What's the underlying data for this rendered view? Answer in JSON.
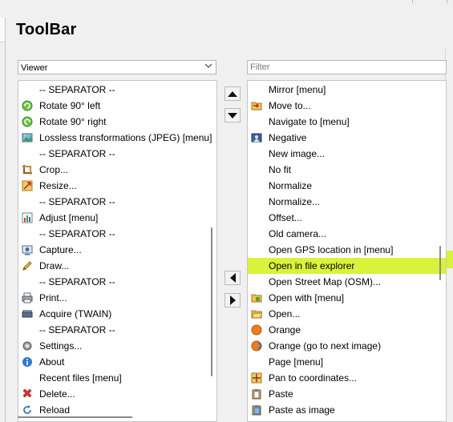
{
  "page": {
    "title": "ToolBar"
  },
  "left": {
    "dropdown_value": "Viewer",
    "items": [
      {
        "label": "-- SEPARATOR --",
        "icon": ""
      },
      {
        "label": "Rotate 90° left",
        "icon": "rotate-left-icon"
      },
      {
        "label": "Rotate 90° right",
        "icon": "rotate-right-icon"
      },
      {
        "label": "Lossless transformations (JPEG) [menu]",
        "icon": "lossless-transform-icon"
      },
      {
        "label": "-- SEPARATOR --",
        "icon": ""
      },
      {
        "label": "Crop...",
        "icon": "crop-icon"
      },
      {
        "label": "Resize...",
        "icon": "resize-icon"
      },
      {
        "label": "-- SEPARATOR --",
        "icon": ""
      },
      {
        "label": "Adjust [menu]",
        "icon": "adjust-icon"
      },
      {
        "label": "-- SEPARATOR --",
        "icon": ""
      },
      {
        "label": "Capture...",
        "icon": "capture-icon"
      },
      {
        "label": "Draw...",
        "icon": "draw-icon"
      },
      {
        "label": "-- SEPARATOR --",
        "icon": ""
      },
      {
        "label": "Print...",
        "icon": "print-icon"
      },
      {
        "label": "Acquire (TWAIN)",
        "icon": "scanner-icon"
      },
      {
        "label": "-- SEPARATOR --",
        "icon": ""
      },
      {
        "label": "Settings...",
        "icon": "settings-icon"
      },
      {
        "label": "About",
        "icon": "about-icon"
      },
      {
        "label": "Recent files [menu]",
        "icon": ""
      },
      {
        "label": "Delete...",
        "icon": "delete-icon"
      },
      {
        "label": "Reload",
        "icon": "reload-icon"
      }
    ]
  },
  "right": {
    "filter_placeholder": "Filter",
    "items": [
      {
        "label": "Mirror [menu]",
        "icon": ""
      },
      {
        "label": "Move to...",
        "icon": "move-to-icon"
      },
      {
        "label": "Navigate to [menu]",
        "icon": ""
      },
      {
        "label": "Negative",
        "icon": "negative-icon"
      },
      {
        "label": "New image...",
        "icon": ""
      },
      {
        "label": "No fit",
        "icon": ""
      },
      {
        "label": "Normalize",
        "icon": ""
      },
      {
        "label": "Normalize...",
        "icon": ""
      },
      {
        "label": "Offset...",
        "icon": ""
      },
      {
        "label": "Old camera...",
        "icon": ""
      },
      {
        "label": "Open GPS location in [menu]",
        "icon": ""
      },
      {
        "label": "Open in file explorer",
        "icon": ""
      },
      {
        "label": "Open Street Map (OSM)...",
        "icon": ""
      },
      {
        "label": "Open with [menu]",
        "icon": "open-with-icon"
      },
      {
        "label": "Open...",
        "icon": "open-folder-icon"
      },
      {
        "label": "Orange",
        "icon": "orange-icon"
      },
      {
        "label": "Orange (go to next image)",
        "icon": "orange-next-icon"
      },
      {
        "label": "Page [menu]",
        "icon": ""
      },
      {
        "label": "Pan to coordinates...",
        "icon": "pan-icon"
      },
      {
        "label": "Paste",
        "icon": "paste-icon"
      },
      {
        "label": "Paste as image",
        "icon": "paste-image-icon"
      }
    ]
  },
  "colors": {
    "selection": "#d9f23a"
  }
}
